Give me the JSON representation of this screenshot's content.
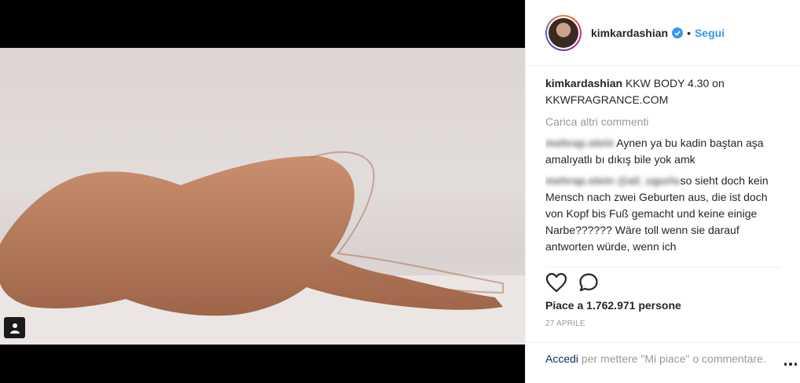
{
  "post": {
    "username": "kimkardashian",
    "dot": "•",
    "follow_label": "Segui"
  },
  "caption": {
    "username": "kimkardashian",
    "text": "KKW BODY 4.30 on KKWFRAGRANCE.COM"
  },
  "comments": {
    "load_more": "Carica altri commenti",
    "items": [
      {
        "username": "mehrap.stein",
        "text": "Aynen ya bu kadin baştan aşa amalıyatlı bı dıkış bile yok amk"
      },
      {
        "username": "mehrap.stein @ali_ugurlu",
        "text": "so sieht doch kein Mensch nach zwei Geburten aus, die ist doch von Kopf bis Fuß gemacht und keine einige Narbe?????? Wäre toll wenn sie darauf antworten würde, wenn ich"
      }
    ]
  },
  "likes_text": "Piace a 1.762.971 persone",
  "date_text": "27 aprile",
  "login": {
    "link": "Accedi",
    "rest": " per mettere \"Mi piace\" o commentare."
  },
  "icons": {
    "like": "heart-icon",
    "comment": "comment-bubble-icon",
    "verified": "verified-badge-icon",
    "tag": "user-tag-icon",
    "more": "more-options-icon"
  },
  "colors": {
    "accent": "#3897f0",
    "text": "#262626",
    "muted": "#999999",
    "link": "#003569"
  }
}
